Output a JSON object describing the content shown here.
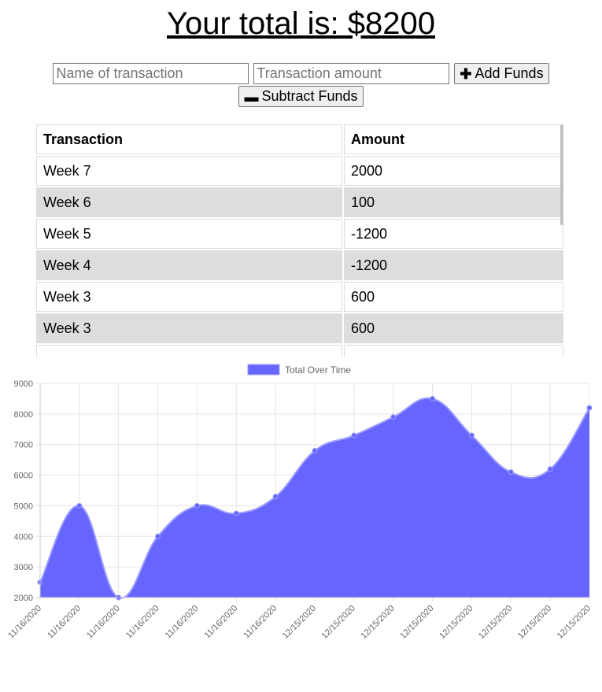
{
  "header": {
    "title": "Your total is: $8200"
  },
  "form": {
    "name_placeholder": "Name of transaction",
    "amount_placeholder": "Transaction amount",
    "add_label": "Add Funds",
    "subtract_label": "Subtract Funds",
    "add_icon": "plus-icon",
    "subtract_icon": "minus-icon"
  },
  "table": {
    "headers": [
      "Transaction",
      "Amount"
    ],
    "rows": [
      {
        "name": "Week 7",
        "amount": "2000"
      },
      {
        "name": "Week 6",
        "amount": "100"
      },
      {
        "name": "Week 5",
        "amount": "-1200"
      },
      {
        "name": "Week 4",
        "amount": "-1200"
      },
      {
        "name": "Week 3",
        "amount": "600"
      },
      {
        "name": "Week 3",
        "amount": "600"
      }
    ]
  },
  "colors": {
    "area_fill": "#6666ff",
    "point": "#6666ff",
    "line": "#9d9dff",
    "alt_row": "#dddddd"
  },
  "chart_data": {
    "type": "area",
    "legend": {
      "label": "Total Over Time",
      "position": "top"
    },
    "x": [
      "11/16/2020",
      "11/16/2020",
      "11/16/2020",
      "11/16/2020",
      "11/16/2020",
      "11/16/2020",
      "11/16/2020",
      "12/15/2020",
      "12/15/2020",
      "12/15/2020",
      "12/15/2020",
      "12/15/2020",
      "12/15/2020",
      "12/15/2020",
      "12/15/2020"
    ],
    "series": [
      {
        "name": "Total Over Time",
        "values": [
          2500,
          5000,
          2000,
          4000,
          5000,
          4750,
          5300,
          6800,
          7300,
          7900,
          8500,
          7300,
          6100,
          6200,
          8200
        ]
      }
    ],
    "ylim": [
      2000,
      9000
    ],
    "yticks": [
      2000,
      3000,
      4000,
      5000,
      6000,
      7000,
      8000,
      9000
    ],
    "grid": true
  }
}
